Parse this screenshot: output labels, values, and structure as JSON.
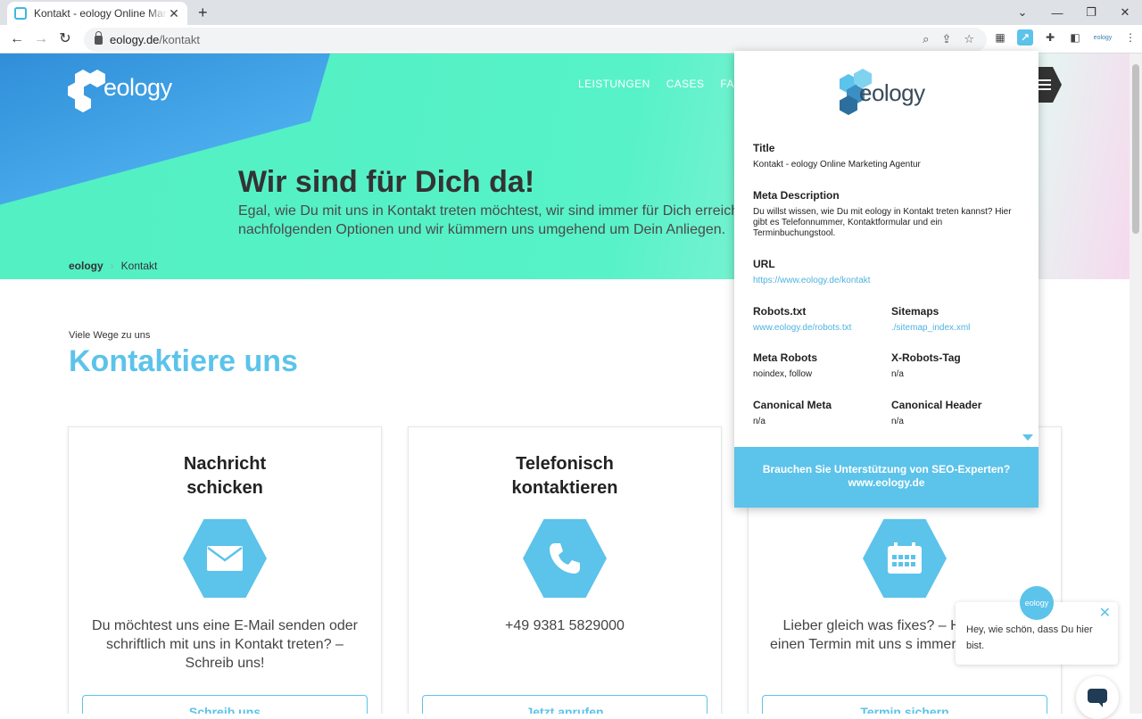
{
  "browser": {
    "tab_title": "Kontakt - eology Online Marketing Agentur",
    "tab_close": "✕",
    "new_tab": "+",
    "url_host": "eology.de",
    "url_path": "/kontakt",
    "window": {
      "minimize": "—",
      "restore": "❐",
      "close": "✕",
      "tabs_menu": "⌄"
    },
    "extension_eology_label": "eology"
  },
  "site": {
    "logo_text": "eology",
    "nav": [
      "LEISTUNGEN",
      "CASES",
      "FAQ"
    ],
    "hero_title": "Wir sind für Dich da!",
    "hero_lead_1": "Egal, wie Du mit uns in Kontakt treten möchtest, wir sind immer für Dich erreich",
    "hero_lead_2": "nachfolgenden Optionen und wir kümmern uns umgehend um Dein Anliegen.",
    "breadcrumb": {
      "home": "eology",
      "current": "Kontakt"
    },
    "section_sub": "Viele Wege zu uns",
    "section_title": "Kontaktiere uns",
    "cards": [
      {
        "title_1": "Nachricht",
        "title_2": "schicken",
        "text": "Du möchtest uns eine E-Mail senden oder schriftlich mit uns in Kontakt treten? – Schreib uns!",
        "button": "Schreib uns"
      },
      {
        "title_1": "Telefonisch",
        "title_2": "kontaktieren",
        "text": "+49 9381 5829000",
        "button": "Jetzt anrufen"
      },
      {
        "title_1": "",
        "title_2": "",
        "text": "Lieber gleich was fixes? – Hier einfach einen Termin mit uns s immer es Dir passt.",
        "button": "Termin sichern"
      }
    ]
  },
  "popup": {
    "logo_text": "eology",
    "title_label": "Title",
    "title_value": "Kontakt - eology Online Marketing Agentur",
    "meta_desc_label": "Meta Description",
    "meta_desc_value": "Du willst wissen, wie Du mit eology in Kontakt treten kannst? Hier gibt es Telefonnummer, Kontaktformular und ein Terminbuchungstool.",
    "url_label": "URL",
    "url_value": "https://www.eology.de/kontakt",
    "robots_label": "Robots.txt",
    "robots_value": "www.eology.de/robots.txt",
    "sitemaps_label": "Sitemaps",
    "sitemaps_value": "./sitemap_index.xml",
    "meta_robots_label": "Meta Robots",
    "meta_robots_value": "noindex, follow",
    "x_robots_label": "X-Robots-Tag",
    "x_robots_value": "n/a",
    "canonical_meta_label": "Canonical Meta",
    "canonical_meta_value": "n/a",
    "canonical_header_label": "Canonical Header",
    "canonical_header_value": "n/a",
    "footer_line_1": "Brauchen Sie Unterstützung von SEO-Experten?",
    "footer_line_2": "www.eology.de"
  },
  "chat": {
    "avatar_text": "eology",
    "message": "Hey, wie schön, dass Du hier bist.",
    "close": "✕"
  },
  "colors": {
    "accent": "#5cc3ea",
    "hero_green": "#52f0c2",
    "hero_blue": "#4fb1f0"
  }
}
